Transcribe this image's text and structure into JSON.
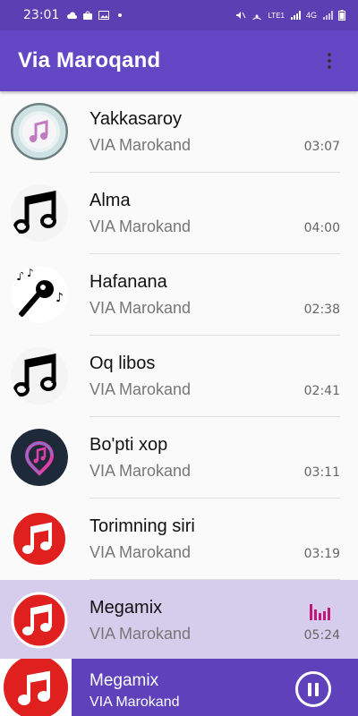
{
  "status": {
    "time": "23:01",
    "network_text": "LTE1",
    "gen": "4G"
  },
  "app": {
    "title": "Via Maroqand",
    "accent": "#6347c4",
    "menu_icon": "more-vert-icon"
  },
  "tracks": [
    {
      "title": "Yakkasaroy",
      "artist": "VIA Marokand",
      "duration": "03:07",
      "art": "music-app-icon"
    },
    {
      "title": "Alma",
      "artist": "VIA Marokand",
      "duration": "04:00",
      "art": "music-notes-icon"
    },
    {
      "title": "Hafanana",
      "artist": "VIA Marokand",
      "duration": "02:38",
      "art": "microphone-icon"
    },
    {
      "title": "Oq libos",
      "artist": "VIA Marokand",
      "duration": "02:41",
      "art": "music-notes-icon"
    },
    {
      "title": "Bo'pti xop",
      "artist": "VIA Marokand",
      "duration": "03:11",
      "art": "music-pin-icon"
    },
    {
      "title": "Torimning siri",
      "artist": "VIA Marokand",
      "duration": "03:19",
      "art": "red-music-icon"
    },
    {
      "title": "Megamix",
      "artist": "VIA Marokand",
      "duration": "05:24",
      "art": "red-music-icon",
      "playing": true
    }
  ],
  "now_playing": {
    "title": "Megamix",
    "artist": "VIA Marokand",
    "control": "pause-icon"
  }
}
